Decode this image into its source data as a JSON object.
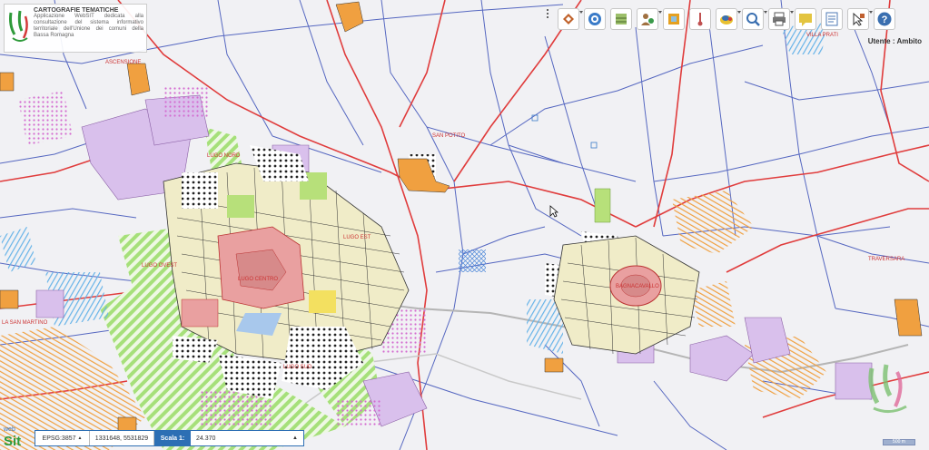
{
  "app": {
    "title": "CARTOGRAFIE TEMATICHE",
    "description": "Applicazione WebSIT dedicata alla consultazione del sistema informativo territoriale dell'Unione dei comuni della Bassa Romagna"
  },
  "toolbar": {
    "tools": [
      {
        "name": "layers-tool-button",
        "icon": "layers-icon",
        "color": "#c0622b"
      },
      {
        "name": "catalog-tool-button",
        "icon": "catalog-icon",
        "color": "#3a7bc8"
      },
      {
        "name": "legend-tool-button",
        "icon": "legend-icon",
        "color": "#6b8e3a"
      },
      {
        "name": "user-tool-button",
        "icon": "user-icon",
        "color": "#a07040"
      },
      {
        "name": "thermometer-tool-button",
        "icon": "thermometer-icon",
        "color": "#c05050"
      },
      {
        "name": "theme-tool-button",
        "icon": "theme-icon",
        "color": "#e5a020"
      },
      {
        "name": "zoom-tool-button",
        "icon": "zoom-icon",
        "color": "#3a6fb0"
      },
      {
        "name": "print-tool-button",
        "icon": "print-icon",
        "color": "#555555"
      },
      {
        "name": "note-tool-button",
        "icon": "note-icon",
        "color": "#e3c440"
      },
      {
        "name": "report-tool-button",
        "icon": "report-icon",
        "color": "#4d79b5"
      },
      {
        "name": "select-tool-button",
        "icon": "select-icon",
        "color": "#c06030"
      },
      {
        "name": "help-tool-button",
        "icon": "help-icon",
        "color": "#3a6fb0"
      }
    ]
  },
  "user_label": "Utente : Ambito",
  "map_labels": [
    {
      "id": "ascensione",
      "text": "ASCENSIONE"
    },
    {
      "id": "lugo-nord",
      "text": "LUGO NORD"
    },
    {
      "id": "san-potito",
      "text": "SAN POTITO"
    },
    {
      "id": "villa-prati",
      "text": "VILLA PRATI"
    },
    {
      "id": "lugo-est",
      "text": "LUGO EST"
    },
    {
      "id": "lugo-ovest",
      "text": "LUGO OVEST"
    },
    {
      "id": "lugo-centro",
      "text": "LUGO CENTRO"
    },
    {
      "id": "bagnacavallo",
      "text": "BAGNACAVALLO"
    },
    {
      "id": "traversara",
      "text": "TRAVERSARA"
    },
    {
      "id": "la-san-martino",
      "text": "LA SAN MARTINO"
    },
    {
      "id": "lugo-sud",
      "text": "LUGO SUD"
    }
  ],
  "status": {
    "epsg": "EPSG:3857",
    "coords": "1331648, 5531829",
    "scale_label": "Scala 1:",
    "scale_value": "24.370"
  },
  "scalebar_text": "500 m",
  "colors": {
    "background": "#f1f1f4",
    "major_road": "#e03c3c",
    "minor_road": "#3a4fb8",
    "urban": "#f0ecc8",
    "historic_center": "#e9a0a0",
    "residential": "#d9c0ec",
    "green_area": "#b7e07a",
    "hatch_green": "#a6e07a",
    "hatch_orange": "#f0a040",
    "hatch_blue": "#66b3e8",
    "brand_blue": "#2d6fb4"
  }
}
